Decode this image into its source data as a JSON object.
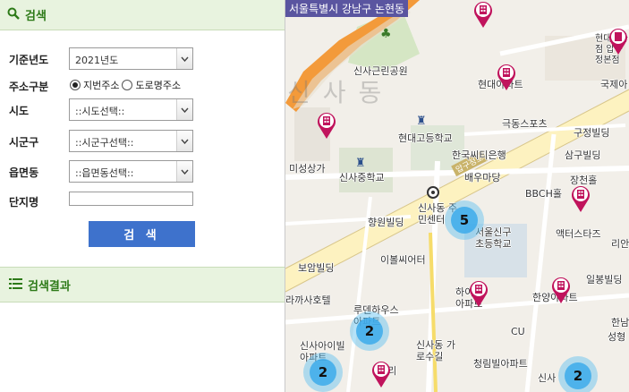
{
  "search_panel": {
    "title": "검색",
    "fields": {
      "year_label": "기준년도",
      "year_value": "2021년도",
      "addr_type_label": "주소구분",
      "addr_jibun": "지번주소",
      "addr_road": "도로명주소",
      "sido_label": "시도",
      "sido_value": "::시도선택::",
      "sigungu_label": "시군구",
      "sigungu_value": "::시군구선택::",
      "eupmyeon_label": "읍면동",
      "eupmyeon_value": "::읍면동선택::",
      "danji_label": "단지명",
      "danji_value": ""
    },
    "search_button": "검 색"
  },
  "results_panel": {
    "title": "검색결과"
  },
  "map": {
    "location_banner": "서울특별시 강남구 논현동",
    "district_watermark": "신사동",
    "road_label": "압구정로",
    "labels": [
      "신사근린공원",
      "현대백화점 압구정본점",
      "국제아",
      "현대아파트",
      "극동스포츠",
      "구정빌딩",
      "현대고등학교",
      "한국씨티은행",
      "삼구빌딩",
      "미성상가",
      "신사중학교",
      "배우마당",
      "장천홀",
      "BBCH홀",
      "신사동 주민센터",
      "향원빌딩",
      "서울신구 초등학교",
      "액터스타즈",
      "리안",
      "이볼씨어터",
      "보암빌딩",
      "일봉빌딩",
      "한양아파트",
      "하이츠 아파트",
      "루덴하우스 아파트",
      "라까사호텔",
      "CU",
      "신사아이빌 아파트",
      "신사동 가로수길",
      "청림빌아파트",
      "나리",
      "신사",
      "한남",
      "성형"
    ],
    "clusters": [
      {
        "count": "5"
      },
      {
        "count": "2"
      },
      {
        "count": "2"
      },
      {
        "count": "2"
      }
    ],
    "colors": {
      "pin": "#c0135c",
      "cluster": "#3eaaeb",
      "arterial": "#f39a3a",
      "header_green": "#2d7a18",
      "button_blue": "#3e72cc"
    }
  }
}
